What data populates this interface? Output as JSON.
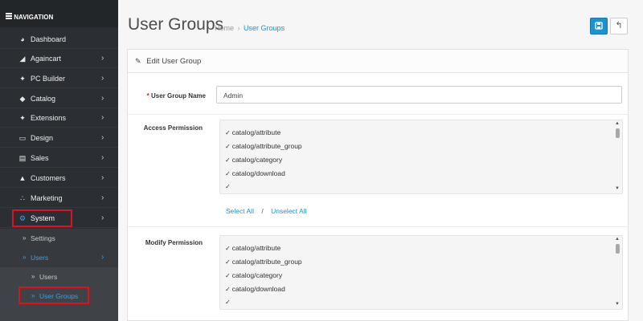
{
  "sidebar": {
    "header": "NAVIGATION",
    "items": [
      {
        "label": "Dashboard",
        "icon": "dashboard-icon",
        "glyph": "◕",
        "chevron": ""
      },
      {
        "label": "Againcart",
        "icon": "tag-icon",
        "glyph": "◢",
        "chevron": "›"
      },
      {
        "label": "PC Builder",
        "icon": "puzzle-icon",
        "glyph": "✦",
        "chevron": "›"
      },
      {
        "label": "Catalog",
        "icon": "tags-icon",
        "glyph": "◆",
        "chevron": "›"
      },
      {
        "label": "Extensions",
        "icon": "puzzle-piece-icon",
        "glyph": "✦",
        "chevron": "›"
      },
      {
        "label": "Design",
        "icon": "monitor-icon",
        "glyph": "▭",
        "chevron": "›"
      },
      {
        "label": "Sales",
        "icon": "cart-icon",
        "glyph": "▤",
        "chevron": "›"
      },
      {
        "label": "Customers",
        "icon": "user-icon",
        "glyph": "▲",
        "chevron": "›"
      },
      {
        "label": "Marketing",
        "icon": "share-icon",
        "glyph": "∴",
        "chevron": "›"
      },
      {
        "label": "System",
        "icon": "gear-icon",
        "glyph": "⚙",
        "chevron": "›"
      }
    ],
    "sub": {
      "settings": "Settings",
      "users": "Users",
      "users_child": "Users",
      "user_groups": "User Groups",
      "bullet": "»",
      "chevron": "›"
    }
  },
  "header": {
    "title": "User Groups",
    "breadcrumb_home": "Home",
    "breadcrumb_sep": "›",
    "breadcrumb_current": "User Groups",
    "back_glyph": "↰"
  },
  "panel": {
    "title": "Edit User Group",
    "pencil_glyph": "✎"
  },
  "form": {
    "name_required": "*",
    "name_label": "User Group Name",
    "name_value": "Admin",
    "access_label": "Access Permission",
    "modify_label": "Modify Permission",
    "check_glyph": "✓",
    "access_options": [
      "catalog/attribute",
      "catalog/attribute_group",
      "catalog/category",
      "catalog/download",
      ""
    ],
    "modify_options": [
      "catalog/attribute",
      "catalog/attribute_group",
      "catalog/category",
      "catalog/download",
      ""
    ],
    "select_all": "Select All",
    "link_sep": "/",
    "unselect_all": "Unselect All",
    "scroll_up": "▲",
    "scroll_down": "▼"
  },
  "colors": {
    "accent": "#1e91cf",
    "sidebar_bg": "#2b2f34",
    "highlight_border": "#e0111b"
  }
}
